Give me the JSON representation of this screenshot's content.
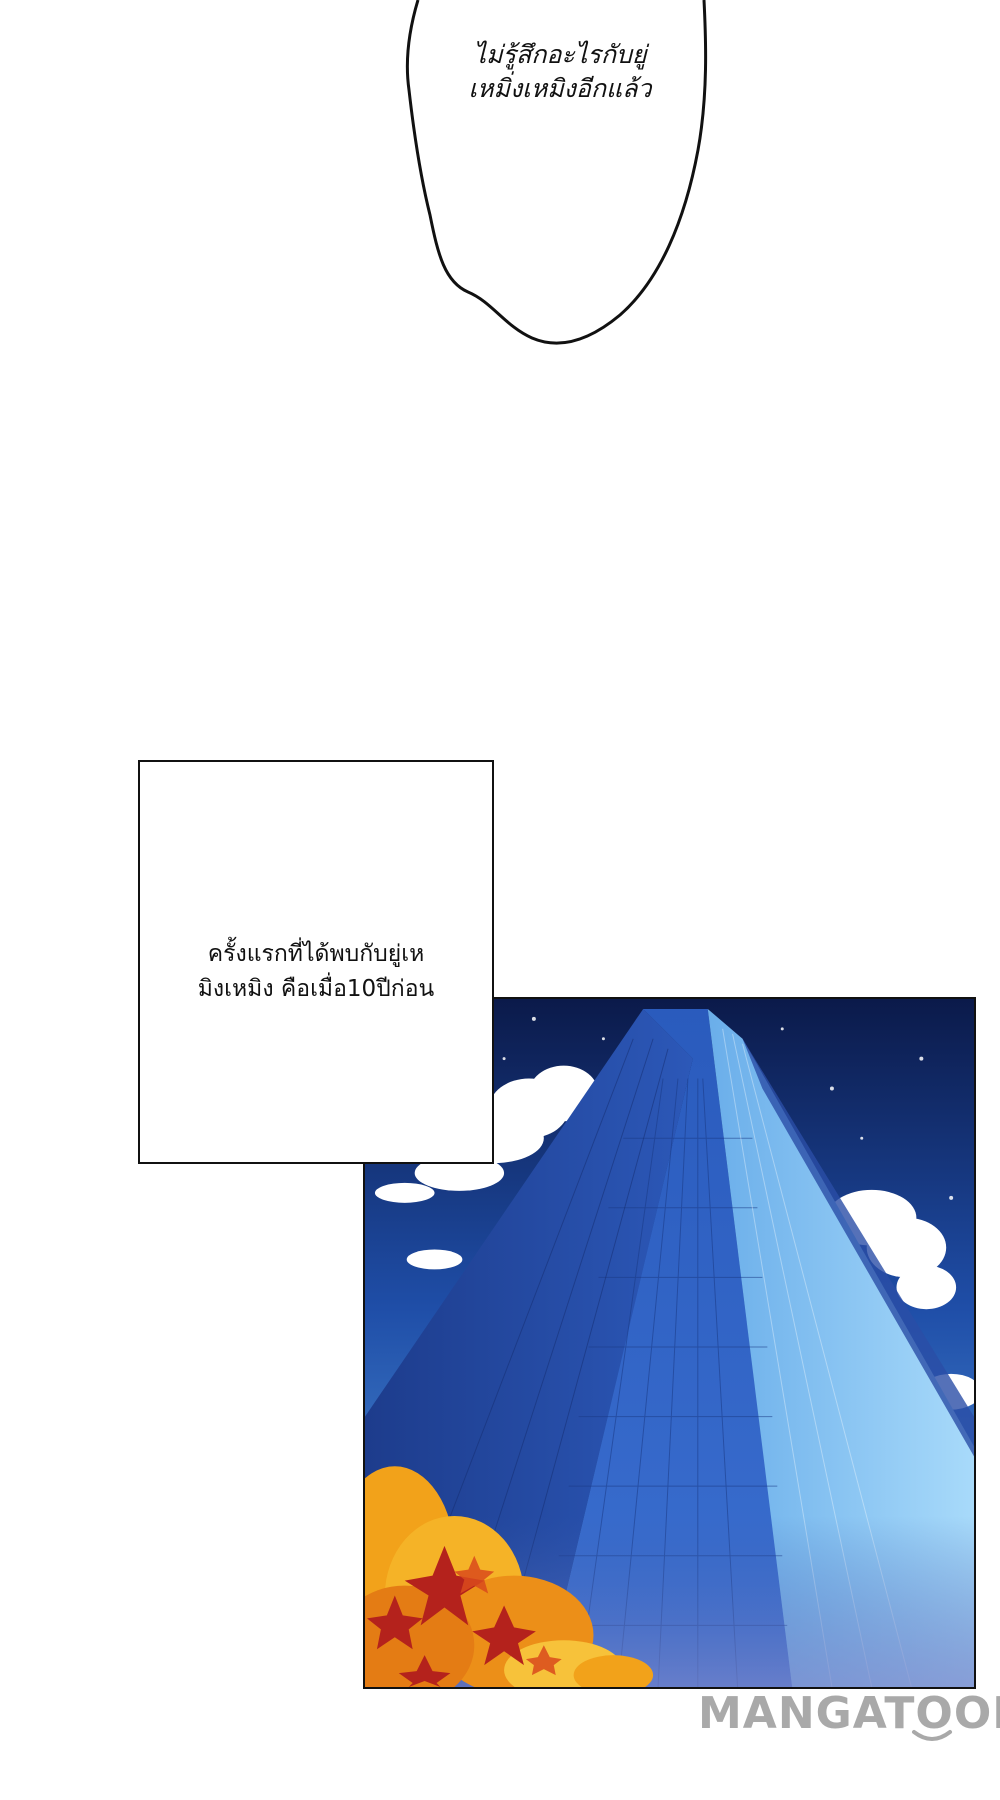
{
  "speech_bubble": {
    "lines": [
      "ไม่รู้สึกอะไรกับยู่",
      "เหมิ่งเหมิงอีกแล้ว"
    ]
  },
  "caption": {
    "lines": [
      "ครั้งแรกที่ได้พบกับยู่เห",
      "มิงเหมิง คือเมื่อ10ปีก่อน"
    ]
  },
  "panel": {
    "colors": {
      "sky_top": "#0b1a4a",
      "sky_mid": "#1f4ea8",
      "sky_low": "#5fa7e6",
      "building_dark": "#1d3c8c",
      "building_mid": "#2f63c4",
      "building_light": "#7fc0f2",
      "foliage_orange": "#f2a21a",
      "foliage_red": "#b4221c"
    }
  },
  "watermark": {
    "text": "MANGATOON",
    "color": "#a9a9a9"
  }
}
